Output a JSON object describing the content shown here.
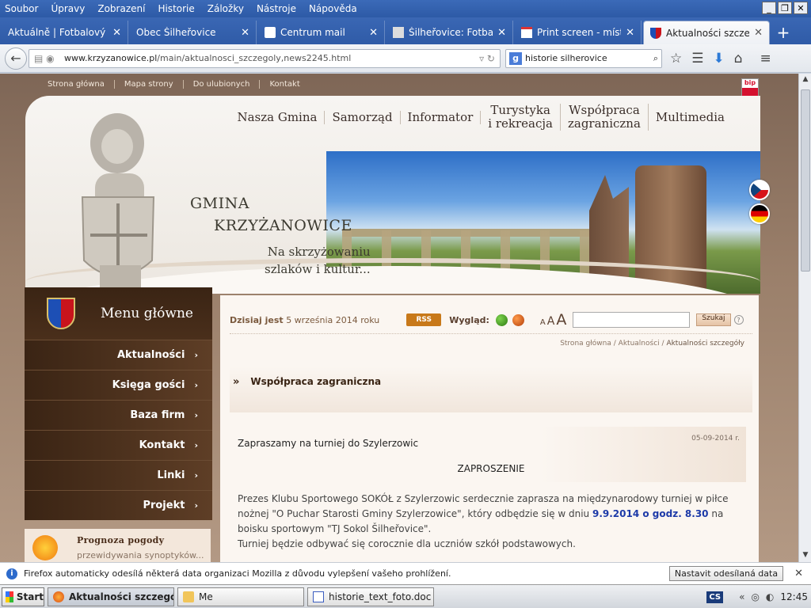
{
  "browser": {
    "menu": [
      "Soubor",
      "Úpravy",
      "Zobrazení",
      "Historie",
      "Záložky",
      "Nástroje",
      "Nápověda"
    ],
    "tabs": [
      {
        "label": "Aktuálně | Fotbalový kl...",
        "icon": "page-icon"
      },
      {
        "label": "Obec Šilheřovice",
        "icon": "page-icon"
      },
      {
        "label": "Centrum mail",
        "icon": "mail-icon"
      },
      {
        "label": "Šilheřovice: Fotbal ...",
        "icon": "web-icon"
      },
      {
        "label": "Print screen - místo...",
        "icon": "gmail-icon"
      },
      {
        "label": "Aktualności szczeg...",
        "icon": "coat-of-arms-icon"
      }
    ],
    "url_domain": "www.krzyzanowice.pl",
    "url_path": "/main/aktualnosci_szczegoly,news2245.html",
    "search_value": "historie silherovice",
    "search_engine_icon": "g"
  },
  "site": {
    "topnav": [
      "Strona główna",
      "Mapa strony",
      "Do ulubionych",
      "Kontakt"
    ],
    "bip_label": "bip",
    "mainnav": [
      {
        "l1": "Nasza Gmina",
        "l2": ""
      },
      {
        "l1": "Samorząd",
        "l2": ""
      },
      {
        "l1": "Informator",
        "l2": ""
      },
      {
        "l1": "Turystyka",
        "l2": "i rekreacja"
      },
      {
        "l1": "Współpraca",
        "l2": "zagraniczna"
      },
      {
        "l1": "Multimedia",
        "l2": ""
      }
    ],
    "gmina_line1": "GMINA",
    "gmina_line2": "KRZYŻANOWICE",
    "motto_line1": "Na skrzyżowaniu",
    "motto_line2": "szlaków i kultur..."
  },
  "sidebar": {
    "title": "Menu główne",
    "items": [
      "Aktualności",
      "Księga gości",
      "Baza firm",
      "Kontakt",
      "Linki",
      "Projekt"
    ],
    "chevron": "›"
  },
  "weather": {
    "title": "Prognoza pogody",
    "subtitle": "przewidywania synoptyków..."
  },
  "toolbar": {
    "today_label": "Dzisiaj jest",
    "today_date": "5 września 2014 roku",
    "rss_label": "RSS",
    "look_label": "Wygląd:",
    "font_a": "A",
    "search_button": "Szukaj",
    "help": "?"
  },
  "breadcrumb": {
    "items": [
      "Strona główna",
      "Aktualności",
      "Aktualności szczegóły"
    ],
    "separator": "/"
  },
  "section": {
    "marker": "»",
    "title": "Współpraca zagraniczna"
  },
  "article": {
    "date": "05-09-2014 r.",
    "title": "Zapraszamy na turniej do Szylerzowic",
    "heading": "ZAPROSZENIE",
    "p1_a": "Prezes Klubu Sportowego SOKÓŁ z Szylerzowic serdecznie zaprasza na międzynarodowy turniej w piłce nożnej \"O Puchar Starosti Gminy Szylerzowice\", który odbędzie się w dniu ",
    "p1_hl": "9.9.2014 o godz. 8.30",
    "p1_b": " na boisku sportowym \"TJ Sokol Šilheřovice\".",
    "p2": "Turniej będzie odbywać się corocznie dla uczniów szkół podstawowych."
  },
  "infobar": {
    "text": "Firefox automaticky odesílá některá data organizaci Mozilla z důvodu vylepšení vašeho prohlížení.",
    "button": "Nastavit odesílaná data"
  },
  "taskbar": {
    "start": "Start",
    "tasks": [
      {
        "label": "Aktualności szczegół...",
        "active": true
      },
      {
        "label": "Me",
        "active": false
      },
      {
        "label": "historie_text_foto.doc - ...",
        "active": false
      }
    ],
    "lang": "CS",
    "tray_arrows": "«",
    "clock": "12:45"
  }
}
